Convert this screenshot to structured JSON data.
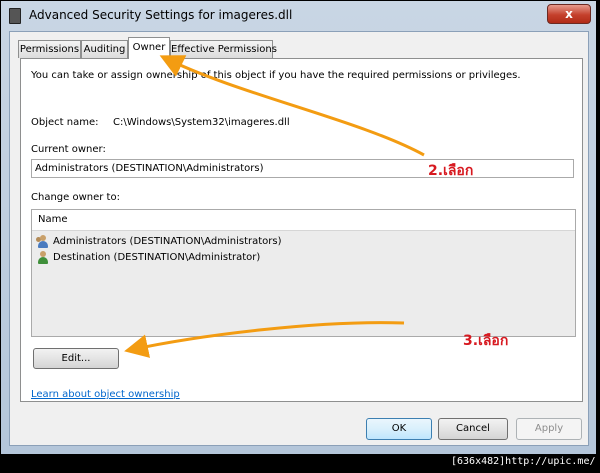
{
  "window": {
    "title": "Advanced Security Settings for imageres.dll",
    "close_glyph": "x"
  },
  "tabs": [
    {
      "label": "Permissions"
    },
    {
      "label": "Auditing"
    },
    {
      "label": "Owner",
      "active": true
    },
    {
      "label": "Effective Permissions"
    }
  ],
  "owner_tab": {
    "intro": "You can take or assign ownership of this object if you have the required permissions or privileges.",
    "object_name_label": "Object name:",
    "object_name_value": "C:\\Windows\\System32\\imageres.dll",
    "current_owner_label": "Current owner:",
    "current_owner_value": "Administrators (DESTINATION\\Administrators)",
    "change_owner_label": "Change owner to:",
    "list_header": "Name",
    "list_items": [
      {
        "label": "Administrators (DESTINATION\\Administrators)",
        "icon": "group-users-icon"
      },
      {
        "label": "Destination (DESTINATION\\Administrator)",
        "icon": "user-icon"
      }
    ],
    "edit_button": "Edit...",
    "learn_link": "Learn about object ownership"
  },
  "buttons": {
    "ok": "OK",
    "cancel": "Cancel",
    "apply": "Apply"
  },
  "annotations": {
    "note_2": "2.เลือก",
    "note_3": "3.เลือก",
    "color": "#f39c12",
    "text_color": "#d71920"
  },
  "watermark": "[636x482]http://upic.me/",
  "colors": {
    "link": "#0066cc",
    "frame": "#b4c6da",
    "close_button": "#c4402c"
  }
}
